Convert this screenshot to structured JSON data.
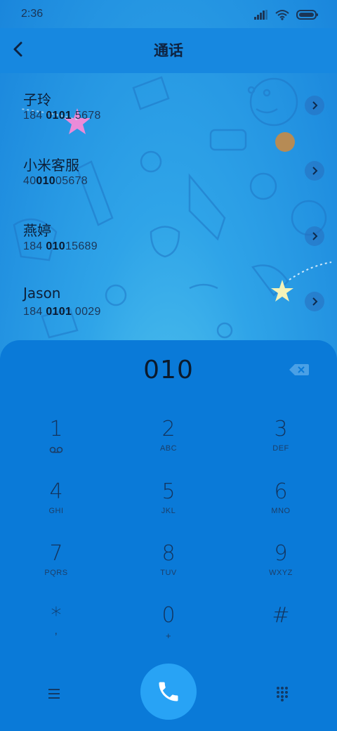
{
  "status_bar": {
    "time": "2:36",
    "icons": [
      "signal-icon",
      "wifi-icon",
      "battery-icon"
    ]
  },
  "header": {
    "title": "通话",
    "back_icon": "chevron-left-icon"
  },
  "query": "010",
  "contacts": [
    {
      "name": "子玲",
      "number_parts": [
        "184 ",
        "0101",
        " 5678"
      ]
    },
    {
      "name": "小米客服",
      "number_parts": [
        "40",
        "010",
        "05678"
      ]
    },
    {
      "name": "燕婷",
      "number_parts": [
        "184 ",
        "010",
        "15689"
      ]
    },
    {
      "name": "Jason",
      "number_parts": [
        "184 ",
        "0101",
        " 0029"
      ]
    }
  ],
  "keypad": [
    {
      "digit": "1",
      "letters": "",
      "icon": "voicemail-icon"
    },
    {
      "digit": "2",
      "letters": "ABC"
    },
    {
      "digit": "3",
      "letters": "DEF"
    },
    {
      "digit": "4",
      "letters": "GHI"
    },
    {
      "digit": "5",
      "letters": "JKL"
    },
    {
      "digit": "6",
      "letters": "MNO"
    },
    {
      "digit": "7",
      "letters": "PQRS"
    },
    {
      "digit": "8",
      "letters": "TUV"
    },
    {
      "digit": "9",
      "letters": "WXYZ"
    },
    {
      "digit": "*",
      "letters": ","
    },
    {
      "digit": "0",
      "letters": "+"
    },
    {
      "digit": "#",
      "letters": ""
    }
  ],
  "colors": {
    "header_bg": "#1788e0",
    "dialer_bg": "#0a7ad8",
    "call_button": "#28a3f5",
    "text_dark": "#0d1f38"
  }
}
